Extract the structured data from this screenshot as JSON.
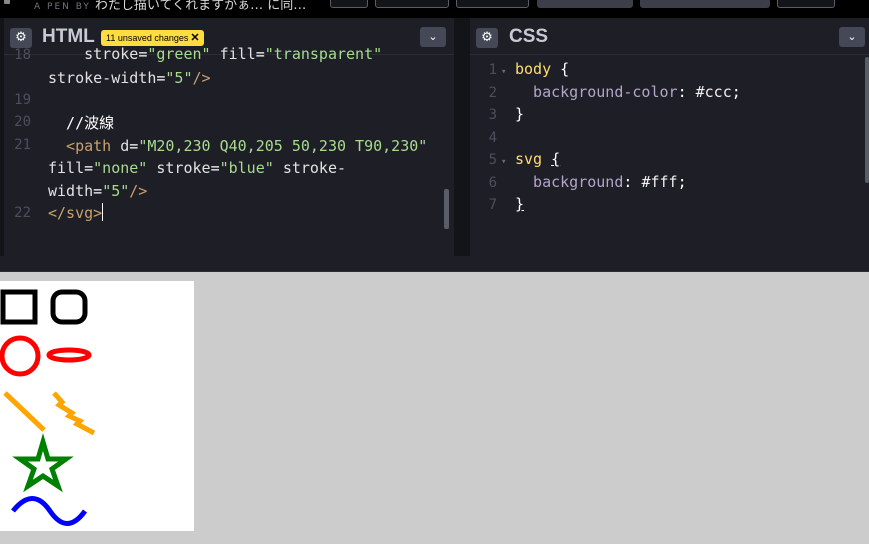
{
  "topbar": {
    "by_label": "A PEN BY",
    "title": "わたし描いてくれますかぁ… に同…"
  },
  "html_panel": {
    "title": "HTML",
    "badge": "11 unsaved changes",
    "badge_close": "✕",
    "gear": "⚙",
    "chevron": "⌄",
    "lines": [
      {
        "num": "18",
        "text": "    stroke=\"green\" fill=\"transparent\""
      },
      {
        "num": "",
        "text": "stroke-width=\"5\"/>"
      },
      {
        "num": "19",
        "text": ""
      },
      {
        "num": "20",
        "text": "  //波線"
      },
      {
        "num": "21",
        "text": "  <path d=\"M20,230 Q40,205 50,230 T90,230\""
      },
      {
        "num": "",
        "text": "fill=\"none\" stroke=\"blue\" stroke-"
      },
      {
        "num": "",
        "text": "width=\"5\"/>"
      },
      {
        "num": "22",
        "text": "</svg>"
      }
    ]
  },
  "css_panel": {
    "title": "CSS",
    "gear": "⚙",
    "chevron": "⌄",
    "lines": [
      {
        "num": "1",
        "text": "body {"
      },
      {
        "num": "2",
        "text": "  background-color: #ccc;"
      },
      {
        "num": "3",
        "text": "}"
      },
      {
        "num": "4",
        "text": ""
      },
      {
        "num": "5",
        "text": "svg {"
      },
      {
        "num": "6",
        "text": "  background: #fff;"
      },
      {
        "num": "7",
        "text": "}"
      }
    ]
  },
  "colors": {
    "editor_bg": "#1e1f26",
    "badge": "#ffdd40",
    "preview_bg": "#cccccc",
    "svg_bg": "#ffffff",
    "red": "#ff0000",
    "orange": "#ffa500",
    "green": "#008000",
    "blue": "#0000ff"
  }
}
